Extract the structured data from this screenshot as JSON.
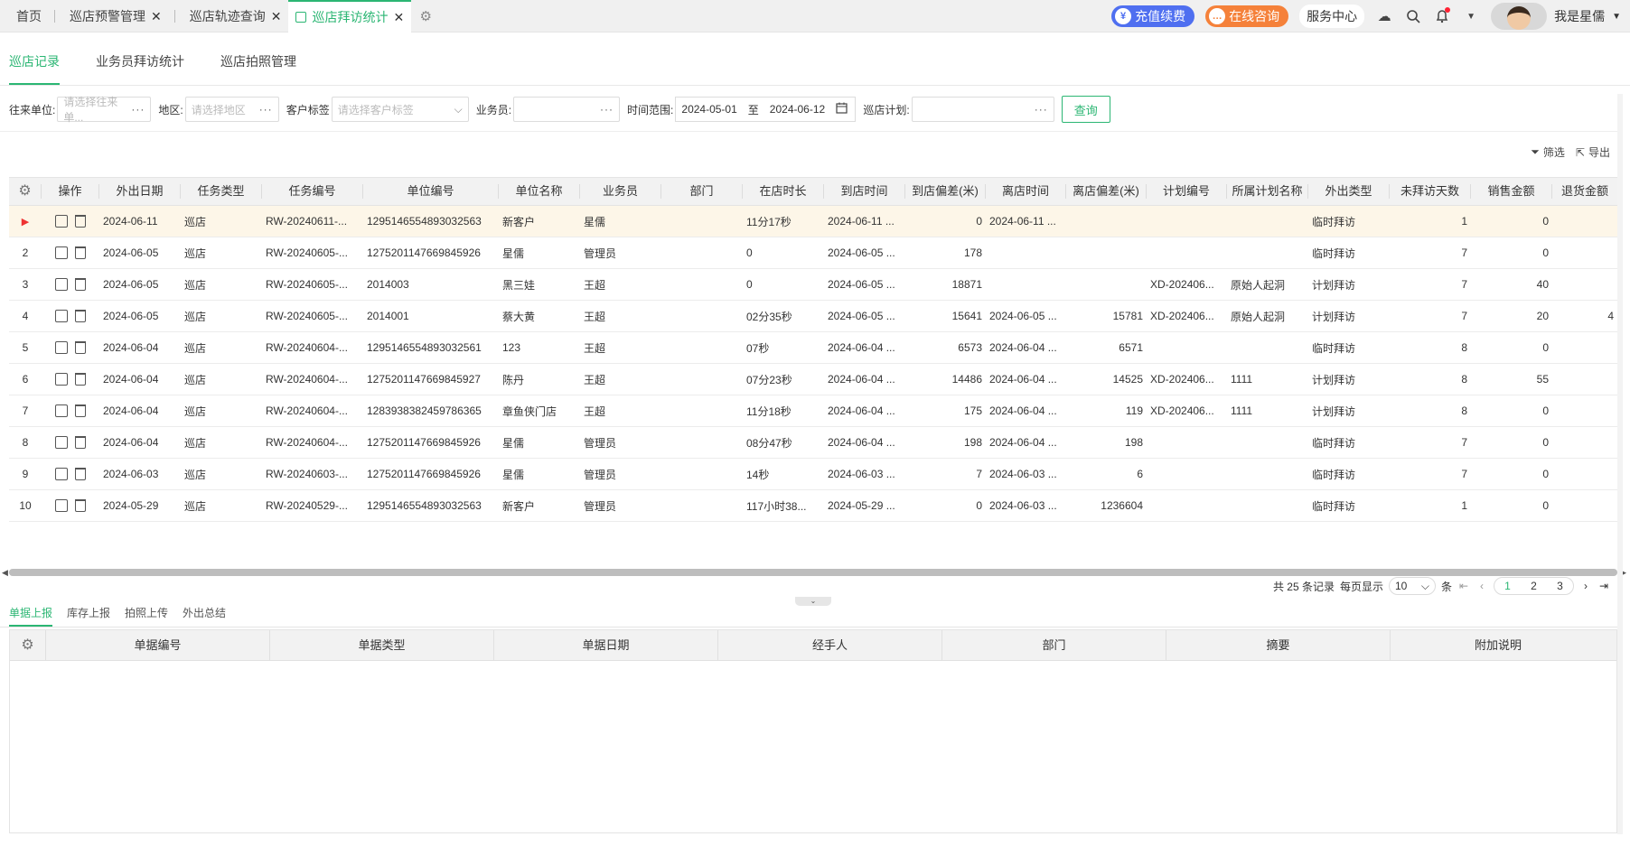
{
  "topbar": {
    "tabs": [
      {
        "label": "首页",
        "closable": false,
        "active": false
      },
      {
        "label": "巡店预警管理",
        "closable": true,
        "active": false
      },
      {
        "label": "巡店轨迹查询",
        "closable": true,
        "active": false
      },
      {
        "label": "巡店拜访统计",
        "closable": true,
        "active": true
      }
    ],
    "renew_label": "充值续费",
    "consult_label": "在线咨询",
    "service_label": "服务中心",
    "user_name": "我是星儒",
    "colors": {
      "accent": "#2bb673",
      "renew": "#4f6ff0",
      "consult": "#f5813a"
    }
  },
  "subtabs": [
    "巡店记录",
    "业务员拜访统计",
    "巡店拍照管理"
  ],
  "filters": {
    "partner_label": "往来单位:",
    "partner_placeholder": "请选择往来单...",
    "region_label": "地区:",
    "region_placeholder": "请选择地区",
    "tag_label": "客户标签",
    "tag_placeholder": "请选择客户标签",
    "staff_label": "业务员:",
    "time_label": "时间范围:",
    "date_from": "2024-05-01",
    "date_to_sep": "至",
    "date_to": "2024-06-12",
    "plan_label": "巡店计划:",
    "query_label": "查询"
  },
  "tools": {
    "filter_label": "筛选",
    "export_label": "导出"
  },
  "table": {
    "columns": [
      "操作",
      "外出日期",
      "任务类型",
      "任务编号",
      "单位编号",
      "单位名称",
      "业务员",
      "部门",
      "在店时长",
      "到店时间",
      "到店偏差(米)",
      "离店时间",
      "离店偏差(米)",
      "计划编号",
      "所属计划名称",
      "外出类型",
      "未拜访天数",
      "销售金额",
      "退货金额"
    ],
    "rows": [
      {
        "idx": "",
        "date": "2024-06-11",
        "type": "巡店",
        "task": "RW-20240611-...",
        "unit_no": "1295146554893032563",
        "unit_name": "新客户",
        "staff": "星儒",
        "dept": "",
        "stay": "11分17秒",
        "arrive": "2024-06-11 ...",
        "arrive_dev": "0",
        "leave": "2024-06-11 ...",
        "leave_dev": "",
        "plan_no": "",
        "plan_name": "",
        "out_type": "临时拜访",
        "days": "1",
        "sales": "0",
        "returns": ""
      },
      {
        "idx": "2",
        "date": "2024-06-05",
        "type": "巡店",
        "task": "RW-20240605-...",
        "unit_no": "1275201147669845926",
        "unit_name": "星儒",
        "staff": "管理员",
        "dept": "",
        "stay": "0",
        "arrive": "2024-06-05 ...",
        "arrive_dev": "178",
        "leave": "",
        "leave_dev": "",
        "plan_no": "",
        "plan_name": "",
        "out_type": "临时拜访",
        "days": "7",
        "sales": "0",
        "returns": ""
      },
      {
        "idx": "3",
        "date": "2024-06-05",
        "type": "巡店",
        "task": "RW-20240605-...",
        "unit_no": "2014003",
        "unit_name": "黑三娃",
        "staff": "王超",
        "dept": "",
        "stay": "0",
        "arrive": "2024-06-05 ...",
        "arrive_dev": "18871",
        "leave": "",
        "leave_dev": "",
        "plan_no": "XD-202406...",
        "plan_name": "原始人起洞",
        "out_type": "计划拜访",
        "days": "7",
        "sales": "40",
        "returns": ""
      },
      {
        "idx": "4",
        "date": "2024-06-05",
        "type": "巡店",
        "task": "RW-20240605-...",
        "unit_no": "2014001",
        "unit_name": "蔡大黄",
        "staff": "王超",
        "dept": "",
        "stay": "02分35秒",
        "arrive": "2024-06-05 ...",
        "arrive_dev": "15641",
        "leave": "2024-06-05 ...",
        "leave_dev": "15781",
        "plan_no": "XD-202406...",
        "plan_name": "原始人起洞",
        "out_type": "计划拜访",
        "days": "7",
        "sales": "20",
        "returns": "4"
      },
      {
        "idx": "5",
        "date": "2024-06-04",
        "type": "巡店",
        "task": "RW-20240604-...",
        "unit_no": "1295146554893032561",
        "unit_name": "123",
        "staff": "王超",
        "dept": "",
        "stay": "07秒",
        "arrive": "2024-06-04 ...",
        "arrive_dev": "6573",
        "leave": "2024-06-04 ...",
        "leave_dev": "6571",
        "plan_no": "",
        "plan_name": "",
        "out_type": "临时拜访",
        "days": "8",
        "sales": "0",
        "returns": ""
      },
      {
        "idx": "6",
        "date": "2024-06-04",
        "type": "巡店",
        "task": "RW-20240604-...",
        "unit_no": "1275201147669845927",
        "unit_name": "陈丹",
        "staff": "王超",
        "dept": "",
        "stay": "07分23秒",
        "arrive": "2024-06-04 ...",
        "arrive_dev": "14486",
        "leave": "2024-06-04 ...",
        "leave_dev": "14525",
        "plan_no": "XD-202406...",
        "plan_name": "1111",
        "out_type": "计划拜访",
        "days": "8",
        "sales": "55",
        "returns": ""
      },
      {
        "idx": "7",
        "date": "2024-06-04",
        "type": "巡店",
        "task": "RW-20240604-...",
        "unit_no": "1283938382459786365",
        "unit_name": "章鱼侠门店",
        "staff": "王超",
        "dept": "",
        "stay": "11分18秒",
        "arrive": "2024-06-04 ...",
        "arrive_dev": "175",
        "leave": "2024-06-04 ...",
        "leave_dev": "119",
        "plan_no": "XD-202406...",
        "plan_name": "1111",
        "out_type": "计划拜访",
        "days": "8",
        "sales": "0",
        "returns": ""
      },
      {
        "idx": "8",
        "date": "2024-06-04",
        "type": "巡店",
        "task": "RW-20240604-...",
        "unit_no": "1275201147669845926",
        "unit_name": "星儒",
        "staff": "管理员",
        "dept": "",
        "stay": "08分47秒",
        "arrive": "2024-06-04 ...",
        "arrive_dev": "198",
        "leave": "2024-06-04 ...",
        "leave_dev": "198",
        "plan_no": "",
        "plan_name": "",
        "out_type": "临时拜访",
        "days": "7",
        "sales": "0",
        "returns": ""
      },
      {
        "idx": "9",
        "date": "2024-06-03",
        "type": "巡店",
        "task": "RW-20240603-...",
        "unit_no": "1275201147669845926",
        "unit_name": "星儒",
        "staff": "管理员",
        "dept": "",
        "stay": "14秒",
        "arrive": "2024-06-03 ...",
        "arrive_dev": "7",
        "leave": "2024-06-03 ...",
        "leave_dev": "6",
        "plan_no": "",
        "plan_name": "",
        "out_type": "临时拜访",
        "days": "7",
        "sales": "0",
        "returns": ""
      },
      {
        "idx": "10",
        "date": "2024-05-29",
        "type": "巡店",
        "task": "RW-20240529-...",
        "unit_no": "1295146554893032563",
        "unit_name": "新客户",
        "staff": "管理员",
        "dept": "",
        "stay": "117小时38...",
        "arrive": "2024-05-29 ...",
        "arrive_dev": "0",
        "leave": "2024-06-03 ...",
        "leave_dev": "1236604",
        "plan_no": "",
        "plan_name": "",
        "out_type": "临时拜访",
        "days": "1",
        "sales": "0",
        "returns": ""
      }
    ]
  },
  "pager": {
    "total_text": "共 25 条记录",
    "per_page_label": "每页显示",
    "per_page": "10",
    "unit": "条",
    "pages": [
      "1",
      "2",
      "3"
    ],
    "current": "1"
  },
  "bottom_tabs": [
    "单据上报",
    "库存上报",
    "拍照上传",
    "外出总结"
  ],
  "bottom_table": {
    "columns": [
      "单据编号",
      "单据类型",
      "单据日期",
      "经手人",
      "部门",
      "摘要",
      "附加说明"
    ]
  }
}
